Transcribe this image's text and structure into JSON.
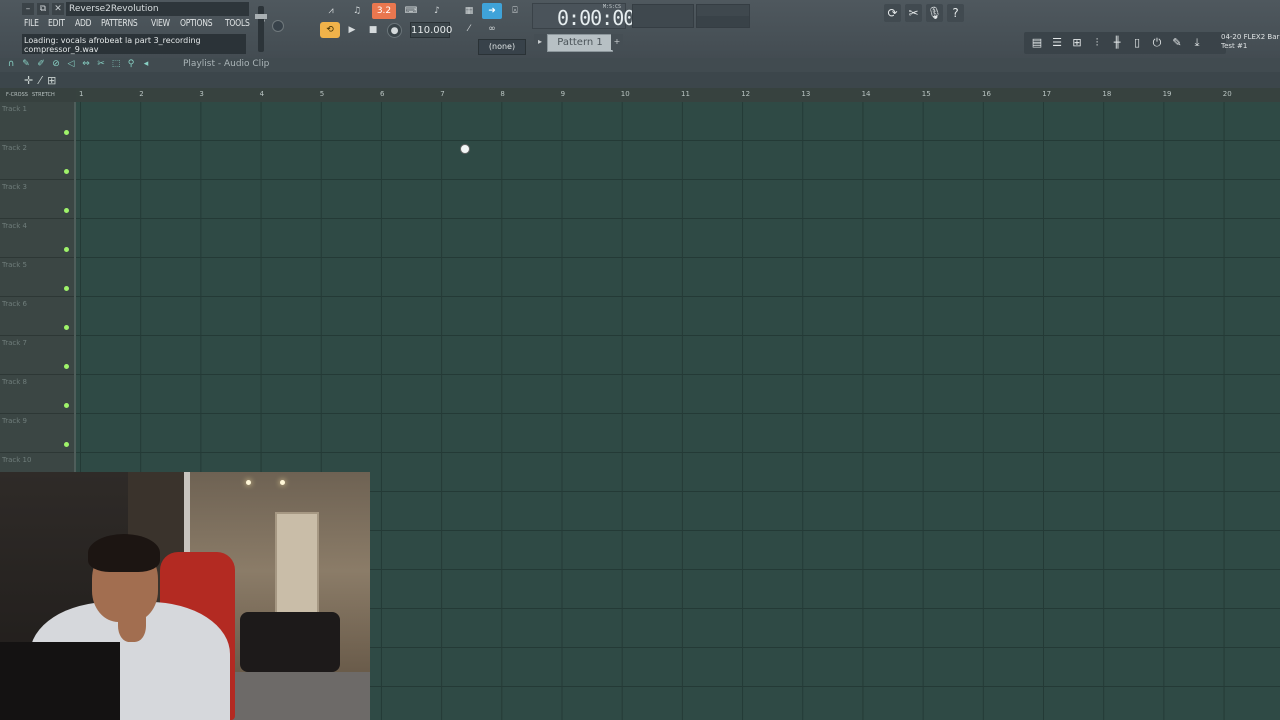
{
  "window": {
    "title": "Reverse2Revolution",
    "controls": [
      "–",
      "⧉",
      "✕"
    ]
  },
  "menu": [
    "FILE",
    "EDIT",
    "ADD",
    "PATTERNS",
    "VIEW",
    "OPTIONS",
    "TOOLS",
    "?"
  ],
  "hint_panel": {
    "line1": "Loading: vocals afrobeat la part 3_recording",
    "line2": "compressor_9.wav"
  },
  "transport": {
    "snap_label": "3.2",
    "tempo": "110.000",
    "time_main": "0:00:00",
    "time_unit": "M:S:CS",
    "pattern_name": "Pattern 1",
    "none_label": "(none)"
  },
  "news": {
    "line1": "04-20 FLEX2 Bar",
    "line2": "Test #1"
  },
  "playlist": {
    "title": "Playlist - Audio Clip",
    "crossfade_label": "F-CROSS",
    "stretch_label": "STRETCH",
    "bar_numbers": [
      "1",
      "2",
      "3",
      "4",
      "5",
      "6",
      "7",
      "8",
      "9",
      "10",
      "11",
      "12",
      "13",
      "14",
      "15",
      "16",
      "17",
      "18",
      "19",
      "20"
    ],
    "tracks": [
      "Track 1",
      "Track 2",
      "Track 3",
      "Track 4",
      "Track 5",
      "Track 6",
      "Track 7",
      "Track 8",
      "Track 9",
      "Track 10"
    ]
  },
  "colors": {
    "grid_bg": "#2f4a45",
    "track_led": "#9ff36a",
    "accent_orange": "#e9774f",
    "accent_blue": "#3fa3d9"
  }
}
